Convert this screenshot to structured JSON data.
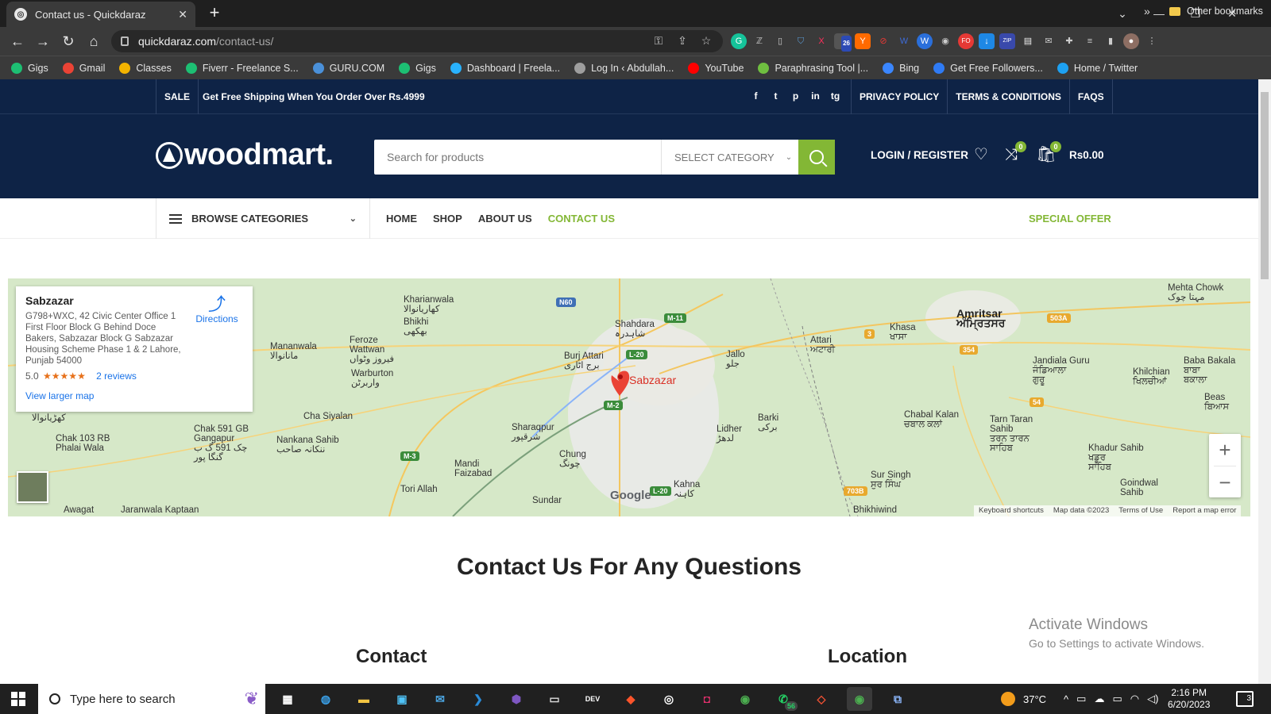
{
  "browser": {
    "tab_title": "Contact us - Quickdaraz",
    "url_host": "quickdaraz.com",
    "url_path": "/contact-us/",
    "bookmarks": [
      {
        "label": "Gigs",
        "color": "#1dbf73"
      },
      {
        "label": "Gmail",
        "color": "#ea4335"
      },
      {
        "label": "Classes",
        "color": "#f4b400"
      },
      {
        "label": "Fiverr - Freelance S...",
        "color": "#1dbf73"
      },
      {
        "label": "GURU.COM",
        "color": "#4a90d9"
      },
      {
        "label": "Gigs",
        "color": "#1dbf73"
      },
      {
        "label": "Dashboard | Freela...",
        "color": "#29b2fe"
      },
      {
        "label": "Log In ‹ Abdullah...",
        "color": "#9e9e9e"
      },
      {
        "label": "YouTube",
        "color": "#ff0000"
      },
      {
        "label": "Paraphrasing Tool |...",
        "color": "#6fbf40"
      },
      {
        "label": "Bing",
        "color": "#3a86ff"
      },
      {
        "label": "Get Free Followers...",
        "color": "#2f7bf5"
      },
      {
        "label": "Home / Twitter",
        "color": "#1da1f2"
      }
    ],
    "other_bookmarks": "Other bookmarks",
    "ext_badge": "26"
  },
  "topbar": {
    "sale": "SALE",
    "promo": "Get Free Shipping When You Order Over Rs.4999",
    "social": [
      "f",
      "t",
      "p",
      "in",
      "tg"
    ],
    "links": [
      "PRIVACY POLICY",
      "TERMS & CONDITIONS",
      "FAQS"
    ]
  },
  "header": {
    "logo": "woodmart.",
    "search_placeholder": "Search for products",
    "category": "SELECT CATEGORY",
    "login": "LOGIN / REGISTER",
    "compare_count": "0",
    "cart_count": "0",
    "cart_total": "Rs0.00"
  },
  "nav": {
    "browse": "BROWSE CATEGORIES",
    "items": [
      {
        "label": "HOME",
        "active": false
      },
      {
        "label": "SHOP",
        "active": false
      },
      {
        "label": "ABOUT US",
        "active": false
      },
      {
        "label": "CONTACT US",
        "active": true
      }
    ],
    "special": "SPECIAL OFFER"
  },
  "map": {
    "place": "Sabzazar",
    "address": "G798+WXC, 42 Civic Center Office 1 First Floor Block G Behind Doce Bakers, Sabzazar Block G Sabzazar Housing Scheme Phase 1 & 2 Lahore, Punjab 54000",
    "rating": "5.0",
    "stars": "★★★★★",
    "reviews": "2 reviews",
    "larger_map": "View larger map",
    "directions": "Directions",
    "pin_label": "Sabzazar",
    "google": "Google",
    "attribution": [
      "Keyboard shortcuts",
      "Map data ©2023",
      "Terms of Use",
      "Report a map error"
    ],
    "labels": [
      {
        "id": "kharianwala",
        "text": "Kharianwala\nکھاریانوالا"
      },
      {
        "id": "bhikhi",
        "text": "Bhikhi\nبھکھی"
      },
      {
        "id": "shahdara",
        "text": "Shahdara\nشاہدرہ"
      },
      {
        "id": "amritsar",
        "text": "Amritsar\nਅੰਮ੍ਰਿਤਸਰ"
      },
      {
        "id": "mehta",
        "text": "Mehta Chowk\nمہتا چوک"
      },
      {
        "id": "manawala",
        "text": "Mananwala\nمانانوالا"
      },
      {
        "id": "feroze",
        "text": "Feroze\nWattwan\nفیروز وٹواں"
      },
      {
        "id": "warburton",
        "text": "Warburton\nواربرٹن"
      },
      {
        "id": "burj",
        "text": "Burj Attari\nبرج اٹاری"
      },
      {
        "id": "jallo",
        "text": "Jallo\nجلو"
      },
      {
        "id": "attari",
        "text": "Attari\nਅਟਾਰੀ"
      },
      {
        "id": "khasa",
        "text": "Khasa\nਖਾਸਾ"
      },
      {
        "id": "jandiala",
        "text": "Jandiala Guru\nਜੰਡਿਆਲਾ\nਗੁਰੂ"
      },
      {
        "id": "khilchian",
        "text": "Khilchian\nਖਿਲਚੀਆਂ"
      },
      {
        "id": "baba",
        "text": "Baba Bakala\nਬਾਬਾ\nਬਕਾਲਾ"
      },
      {
        "id": "beas",
        "text": "Beas\nਬਿਆਸ"
      },
      {
        "id": "chasiyalan",
        "text": "Cha Siyalan"
      },
      {
        "id": "chak591",
        "text": "Chak 591 GB\nGangapur\nچک 591 گ ب\nگنگا پور"
      },
      {
        "id": "nankana",
        "text": "Nankana Sahib\nننکانہ صاحب"
      },
      {
        "id": "chak103",
        "text": "Chak 103 RB\nPhalai Wala"
      },
      {
        "id": "sharaqpur",
        "text": "Sharaqpur\nشرقپور"
      },
      {
        "id": "chung",
        "text": "Chung\nچونگ"
      },
      {
        "id": "mandi",
        "text": "Mandi\nFaizabad"
      },
      {
        "id": "lidher",
        "text": "Lidher\nلدھڑ"
      },
      {
        "id": "barki",
        "text": "Barki\nبرکی"
      },
      {
        "id": "chabal",
        "text": "Chabal Kalan\nਚਬਾਲ ਕਲਾਂ"
      },
      {
        "id": "tarn",
        "text": "Tarn Taran\nSahib\nਤਰਨ ਤਾਰਨ\nਸਾਹਿਬ"
      },
      {
        "id": "khadur",
        "text": "Khadur Sahib\nਖਡੂਰ\nਸਾਹਿਬ"
      },
      {
        "id": "toriallah",
        "text": "Tori Allah"
      },
      {
        "id": "awagat",
        "text": "Awagat"
      },
      {
        "id": "jaranwala",
        "text": "Jaranwala  Kaptaan"
      },
      {
        "id": "sundar",
        "text": "Sundar"
      },
      {
        "id": "kahna",
        "text": "Kahna\nکاہنہ"
      },
      {
        "id": "sursingh",
        "text": "Sur Singh\nਸੁਰ ਸਿੰਘ"
      },
      {
        "id": "bhikhiwind",
        "text": "Bhikhiwind"
      },
      {
        "id": "goindwal",
        "text": "Goindwal\nSahib"
      },
      {
        "id": "kharianwala2",
        "text": "کھڑیانوالا"
      }
    ],
    "shields": [
      {
        "id": "n60",
        "text": "N60",
        "color": "#3f6fb5"
      },
      {
        "id": "m11",
        "text": "M-11",
        "color": "#3b8c3b"
      },
      {
        "id": "l20a",
        "text": "L-20",
        "color": "#3b8c3b"
      },
      {
        "id": "m2",
        "text": "M-2",
        "color": "#3b8c3b"
      },
      {
        "id": "m3",
        "text": "M-3",
        "color": "#3b8c3b"
      },
      {
        "id": "l20b",
        "text": "L-20",
        "color": "#3b8c3b"
      },
      {
        "id": "s3",
        "text": "3",
        "color": "#e8a92e"
      },
      {
        "id": "s354",
        "text": "354",
        "color": "#e8a92e"
      },
      {
        "id": "s503a",
        "text": "503A",
        "color": "#e8a92e"
      },
      {
        "id": "s54",
        "text": "54",
        "color": "#e8a92e"
      },
      {
        "id": "s703b",
        "text": "703B",
        "color": "#e8a92e"
      }
    ]
  },
  "content": {
    "heading": "Contact Us For Any Questions",
    "contact": "Contact",
    "location": "Location"
  },
  "watermark": {
    "line1": "Activate Windows",
    "line2": "Go to Settings to activate Windows."
  },
  "taskbar": {
    "search_placeholder": "Type here to search",
    "temperature": "37°C",
    "time": "2:16 PM",
    "date": "6/20/2023",
    "notifications": "3",
    "whatsapp_badge": "56"
  }
}
